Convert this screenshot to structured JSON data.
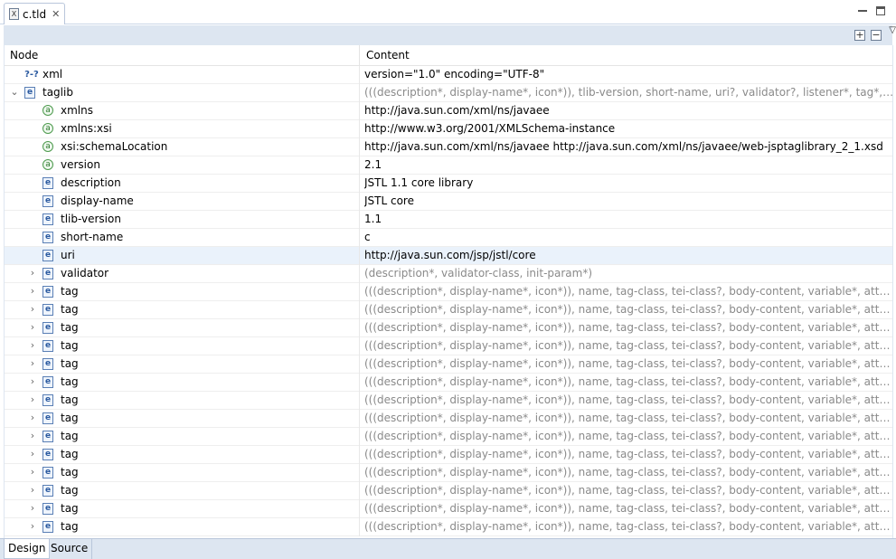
{
  "editor": {
    "tab_label": "c.tld",
    "tab_icon_glyph": "X",
    "close_glyph": "✕"
  },
  "tree": {
    "columns": {
      "node": "Node",
      "content": "Content"
    },
    "rows": [
      {
        "depth": 0,
        "twisty": "",
        "icon": "pi",
        "label": "xml",
        "content": "version=\"1.0\" encoding=\"UTF-8\"",
        "gray": false,
        "selected": false
      },
      {
        "depth": 0,
        "twisty": "open",
        "icon": "e",
        "label": "taglib",
        "content": "(((description*, display-name*, icon*)), tlib-version, short-name, uri?, validator?, listener*, tag*, tag-f...",
        "gray": true,
        "selected": false
      },
      {
        "depth": 1,
        "twisty": "",
        "icon": "a",
        "label": "xmlns",
        "content": "http://java.sun.com/xml/ns/javaee",
        "gray": false,
        "selected": false
      },
      {
        "depth": 1,
        "twisty": "",
        "icon": "a",
        "label": "xmlns:xsi",
        "content": "http://www.w3.org/2001/XMLSchema-instance",
        "gray": false,
        "selected": false
      },
      {
        "depth": 1,
        "twisty": "",
        "icon": "a",
        "label": "xsi:schemaLocation",
        "content": "http://java.sun.com/xml/ns/javaee http://java.sun.com/xml/ns/javaee/web-jsptaglibrary_2_1.xsd",
        "gray": false,
        "selected": false
      },
      {
        "depth": 1,
        "twisty": "",
        "icon": "a",
        "label": "version",
        "content": "2.1",
        "gray": false,
        "selected": false
      },
      {
        "depth": 1,
        "twisty": "",
        "icon": "e",
        "label": "description",
        "content": "JSTL 1.1 core library",
        "gray": false,
        "selected": false
      },
      {
        "depth": 1,
        "twisty": "",
        "icon": "e",
        "label": "display-name",
        "content": "JSTL core",
        "gray": false,
        "selected": false
      },
      {
        "depth": 1,
        "twisty": "",
        "icon": "e",
        "label": "tlib-version",
        "content": "1.1",
        "gray": false,
        "selected": false
      },
      {
        "depth": 1,
        "twisty": "",
        "icon": "e",
        "label": "short-name",
        "content": "c",
        "gray": false,
        "selected": false
      },
      {
        "depth": 1,
        "twisty": "",
        "icon": "e",
        "label": "uri",
        "content": "http://java.sun.com/jsp/jstl/core",
        "gray": false,
        "selected": true
      },
      {
        "depth": 1,
        "twisty": "closed",
        "icon": "e",
        "label": "validator",
        "content": "(description*, validator-class, init-param*)",
        "gray": true,
        "selected": false
      },
      {
        "depth": 1,
        "twisty": "closed",
        "icon": "e",
        "label": "tag",
        "content": "(((description*, display-name*, icon*)), name, tag-class, tei-class?, body-content, variable*, attribute...",
        "gray": true,
        "selected": false
      },
      {
        "depth": 1,
        "twisty": "closed",
        "icon": "e",
        "label": "tag",
        "content": "(((description*, display-name*, icon*)), name, tag-class, tei-class?, body-content, variable*, attribute...",
        "gray": true,
        "selected": false
      },
      {
        "depth": 1,
        "twisty": "closed",
        "icon": "e",
        "label": "tag",
        "content": "(((description*, display-name*, icon*)), name, tag-class, tei-class?, body-content, variable*, attribute...",
        "gray": true,
        "selected": false
      },
      {
        "depth": 1,
        "twisty": "closed",
        "icon": "e",
        "label": "tag",
        "content": "(((description*, display-name*, icon*)), name, tag-class, tei-class?, body-content, variable*, attribute...",
        "gray": true,
        "selected": false
      },
      {
        "depth": 1,
        "twisty": "closed",
        "icon": "e",
        "label": "tag",
        "content": "(((description*, display-name*, icon*)), name, tag-class, tei-class?, body-content, variable*, attribute...",
        "gray": true,
        "selected": false
      },
      {
        "depth": 1,
        "twisty": "closed",
        "icon": "e",
        "label": "tag",
        "content": "(((description*, display-name*, icon*)), name, tag-class, tei-class?, body-content, variable*, attribute...",
        "gray": true,
        "selected": false
      },
      {
        "depth": 1,
        "twisty": "closed",
        "icon": "e",
        "label": "tag",
        "content": "(((description*, display-name*, icon*)), name, tag-class, tei-class?, body-content, variable*, attribute...",
        "gray": true,
        "selected": false
      },
      {
        "depth": 1,
        "twisty": "closed",
        "icon": "e",
        "label": "tag",
        "content": "(((description*, display-name*, icon*)), name, tag-class, tei-class?, body-content, variable*, attribute...",
        "gray": true,
        "selected": false
      },
      {
        "depth": 1,
        "twisty": "closed",
        "icon": "e",
        "label": "tag",
        "content": "(((description*, display-name*, icon*)), name, tag-class, tei-class?, body-content, variable*, attribute...",
        "gray": true,
        "selected": false
      },
      {
        "depth": 1,
        "twisty": "closed",
        "icon": "e",
        "label": "tag",
        "content": "(((description*, display-name*, icon*)), name, tag-class, tei-class?, body-content, variable*, attribute...",
        "gray": true,
        "selected": false
      },
      {
        "depth": 1,
        "twisty": "closed",
        "icon": "e",
        "label": "tag",
        "content": "(((description*, display-name*, icon*)), name, tag-class, tei-class?, body-content, variable*, attribute...",
        "gray": true,
        "selected": false
      },
      {
        "depth": 1,
        "twisty": "closed",
        "icon": "e",
        "label": "tag",
        "content": "(((description*, display-name*, icon*)), name, tag-class, tei-class?, body-content, variable*, attribute...",
        "gray": true,
        "selected": false
      },
      {
        "depth": 1,
        "twisty": "closed",
        "icon": "e",
        "label": "tag",
        "content": "(((description*, display-name*, icon*)), name, tag-class, tei-class?, body-content, variable*, attribute...",
        "gray": true,
        "selected": false
      },
      {
        "depth": 1,
        "twisty": "closed",
        "icon": "e",
        "label": "tag",
        "content": "(((description*, display-name*, icon*)), name, tag-class, tei-class?, body-content, variable*, attribute...",
        "gray": true,
        "selected": false
      }
    ]
  },
  "icon_glyphs": {
    "e": "e",
    "a": "a",
    "pi": "?-?"
  },
  "bottom_tabs": {
    "design": "Design",
    "source": "Source"
  },
  "colors": {
    "selected_row": "#eaf2fb",
    "content_gray": "#8a8a8a",
    "toolbar": "#dde6f1"
  }
}
